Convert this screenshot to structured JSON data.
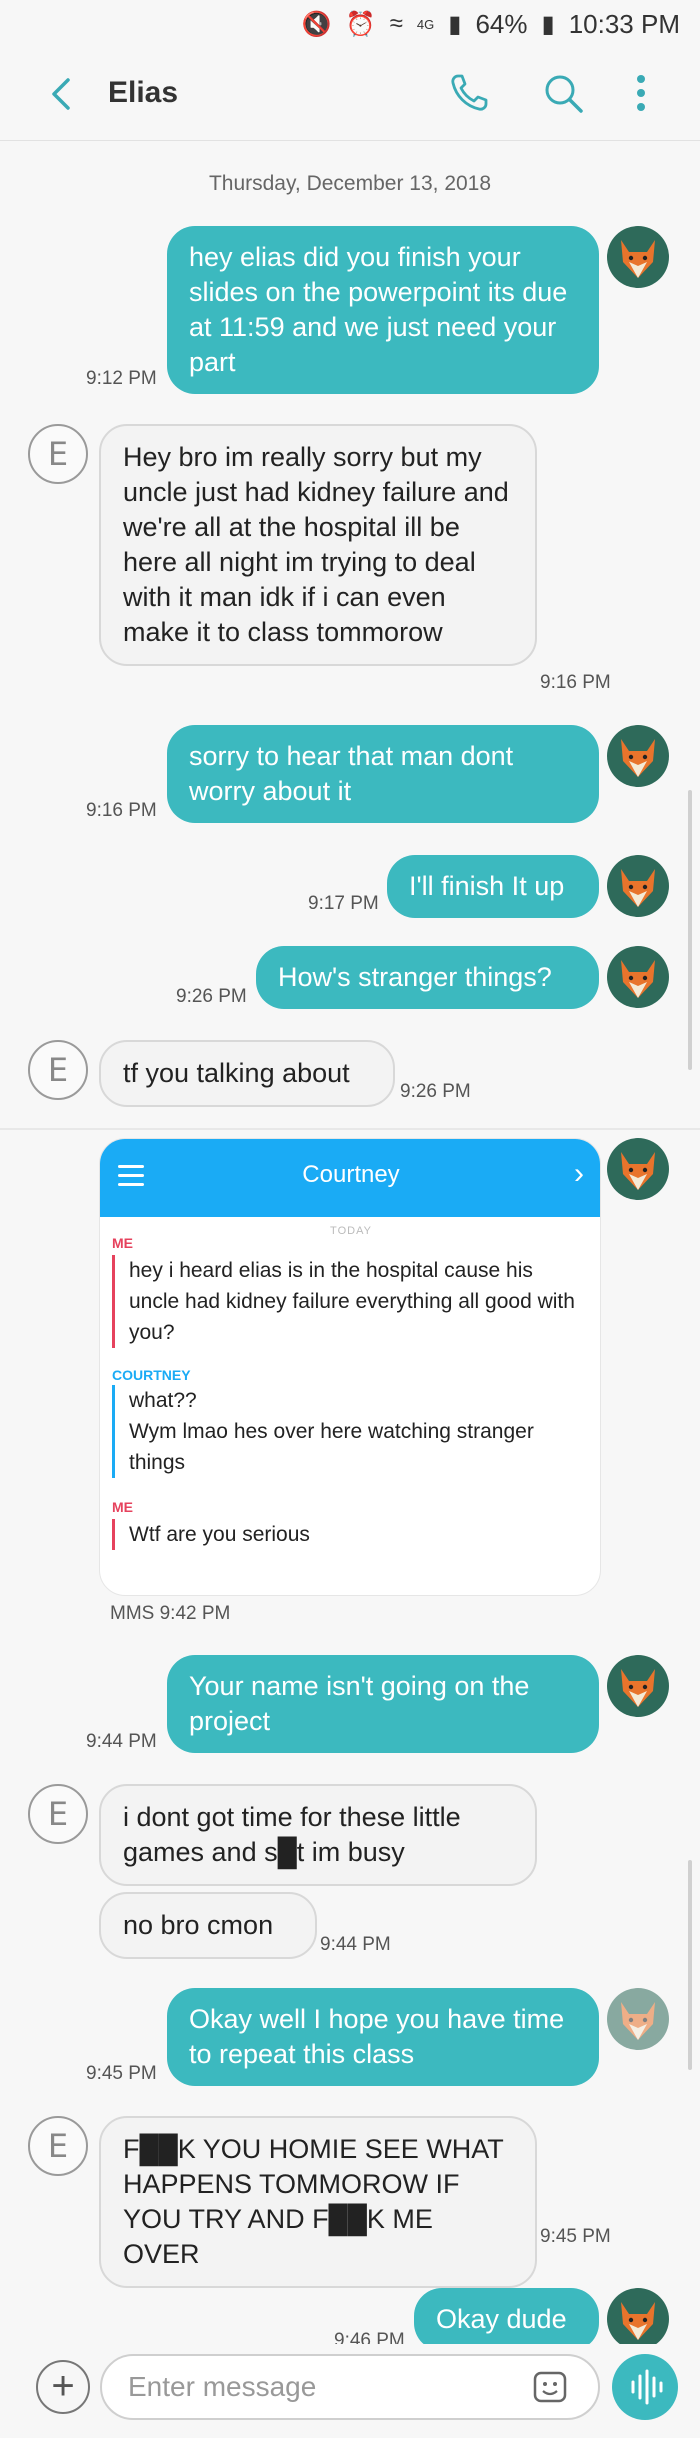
{
  "status_bar": {
    "battery": "64%",
    "time": "10:33 PM",
    "network": "4G"
  },
  "header": {
    "contact_name": "Elias"
  },
  "conversation": {
    "date": "Thursday, December 13, 2018",
    "contact_initial": "E",
    "messages": [
      {
        "dir": "out",
        "text": "hey elias did you finish your slides on the powerpoint its due at 11:59 and we just need your part",
        "time": "9:12 PM"
      },
      {
        "dir": "in",
        "text": "Hey bro im really sorry but my uncle just had kidney failure and we're all at the hospital ill be here all night im trying to deal with it man idk if i can even make it to class tommorow",
        "time": "9:16 PM"
      },
      {
        "dir": "out",
        "text": "sorry to hear that man dont worry about it",
        "time": "9:16 PM"
      },
      {
        "dir": "out",
        "text": "I'll finish It up",
        "time": "9:17 PM"
      },
      {
        "dir": "out",
        "text": "How's stranger things?",
        "time": "9:26 PM"
      },
      {
        "dir": "in",
        "text": "tf you talking about",
        "time": "9:26 PM"
      },
      {
        "dir": "out",
        "text": "Your name isn't going on the project",
        "time": "9:44 PM"
      },
      {
        "dir": "in",
        "text": "i dont got time for these little games and s█t im busy",
        "time": ""
      },
      {
        "dir": "in",
        "text": "no bro cmon",
        "time": "9:44 PM"
      },
      {
        "dir": "out",
        "text": "Okay well I hope you have time to repeat this class",
        "time": "9:45 PM"
      },
      {
        "dir": "in",
        "text": "F██K YOU HOMIE SEE WHAT HAPPENS TOMMOROW IF YOU TRY AND F██K ME OVER",
        "time": "9:45 PM"
      },
      {
        "dir": "out",
        "text": "Okay dude",
        "time": "9:46 PM"
      }
    ],
    "mms": {
      "label": "MMS 9:42 PM",
      "title": "Courtney",
      "today": "TODAY",
      "entries": [
        {
          "sender": "ME",
          "text": "hey i heard elias is in the hospital cause his uncle had kidney failure everything all good with you?"
        },
        {
          "sender": "COURTNEY",
          "text": "what??"
        },
        {
          "sender": "COURTNEY",
          "text": "Wym lmao hes over here watching stranger things"
        },
        {
          "sender": "ME",
          "text": "Wtf are you serious"
        }
      ]
    }
  },
  "composer": {
    "placeholder": "Enter message"
  },
  "colors": {
    "outgoing": "#3cb9bf",
    "incoming": "#f3f3f3",
    "snap_header": "#1aabf5",
    "me_accent": "#e6425d"
  },
  "icons": [
    "back-arrow-icon",
    "phone-icon",
    "search-icon",
    "more-vert-icon",
    "plus-icon",
    "sticker-icon",
    "voice-icon",
    "fox-avatar-icon"
  ]
}
